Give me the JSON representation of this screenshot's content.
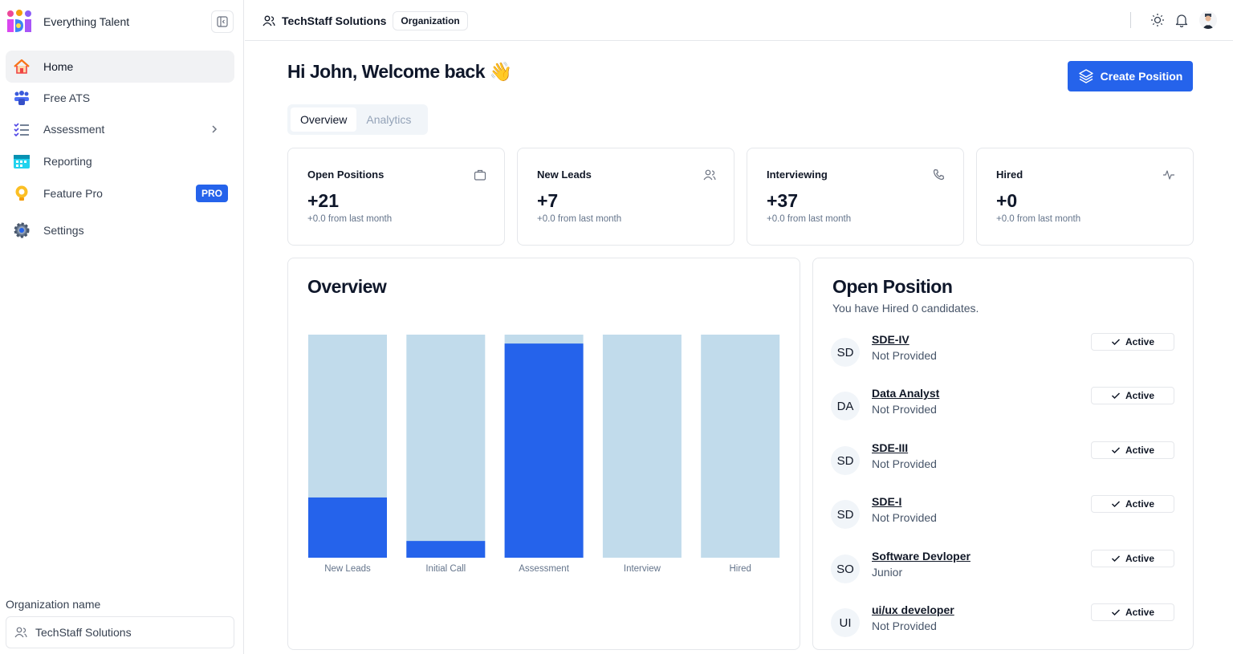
{
  "brand": {
    "name": "Everything Talent"
  },
  "sidebar": {
    "items": [
      {
        "label": "Home",
        "icon": "home-icon",
        "active": true
      },
      {
        "label": "Free ATS",
        "icon": "team-icon"
      },
      {
        "label": "Assessment",
        "icon": "checklist-icon"
      },
      {
        "label": "Reporting",
        "icon": "calendar-icon"
      },
      {
        "label": "Feature Pro",
        "icon": "bulb-icon",
        "badge": "PRO"
      },
      {
        "label": "Settings",
        "icon": "gear-icon"
      }
    ],
    "org_label": "Organization name",
    "org_value": "TechStaff Solutions"
  },
  "topbar": {
    "org_name": "TechStaff Solutions",
    "org_tag": "Organization"
  },
  "main": {
    "greeting": "Hi John, Welcome back 👋",
    "create_button": "Create Position",
    "tabs": [
      {
        "label": "Overview",
        "active": true
      },
      {
        "label": "Analytics",
        "active": false
      }
    ],
    "stats": [
      {
        "title": "Open Positions",
        "value": "+21",
        "sub": "+0.0 from last month",
        "icon": "briefcase-icon"
      },
      {
        "title": "New Leads",
        "value": "+7",
        "sub": "+0.0 from last month",
        "icon": "users-icon"
      },
      {
        "title": "Interviewing",
        "value": "+37",
        "sub": "+0.0 from last month",
        "icon": "phone-icon"
      },
      {
        "title": "Hired",
        "value": "+0",
        "sub": "+0.0 from last month",
        "icon": "activity-icon"
      }
    ],
    "overview_title": "Overview",
    "open_position_title": "Open Position",
    "open_position_sub": "You have Hired 0 candidates.",
    "positions": [
      {
        "initials": "SD",
        "name": "SDE-IV",
        "level": "Not Provided",
        "status": "Active"
      },
      {
        "initials": "DA",
        "name": "Data Analyst",
        "level": "Not Provided",
        "status": "Active"
      },
      {
        "initials": "SD",
        "name": "SDE-III",
        "level": "Not Provided",
        "status": "Active"
      },
      {
        "initials": "SD",
        "name": "SDE-I",
        "level": "Not Provided",
        "status": "Active"
      },
      {
        "initials": "SO",
        "name": "Software Devloper",
        "level": "Junior",
        "status": "Active"
      },
      {
        "initials": "UI",
        "name": "ui/ux developer",
        "level": "Not Provided",
        "status": "Active"
      }
    ]
  },
  "colors": {
    "accent": "#2563eb",
    "bar_track": "#c1dbeb",
    "bar_fill": "#2563eb"
  },
  "chart_data": {
    "type": "bar",
    "categories": [
      "New Leads",
      "Initial Call",
      "Assessment",
      "Interview",
      "Hired"
    ],
    "values": [
      0.27,
      0.075,
      0.96,
      0,
      0
    ],
    "ylim": [
      0,
      1
    ],
    "grid": false
  }
}
